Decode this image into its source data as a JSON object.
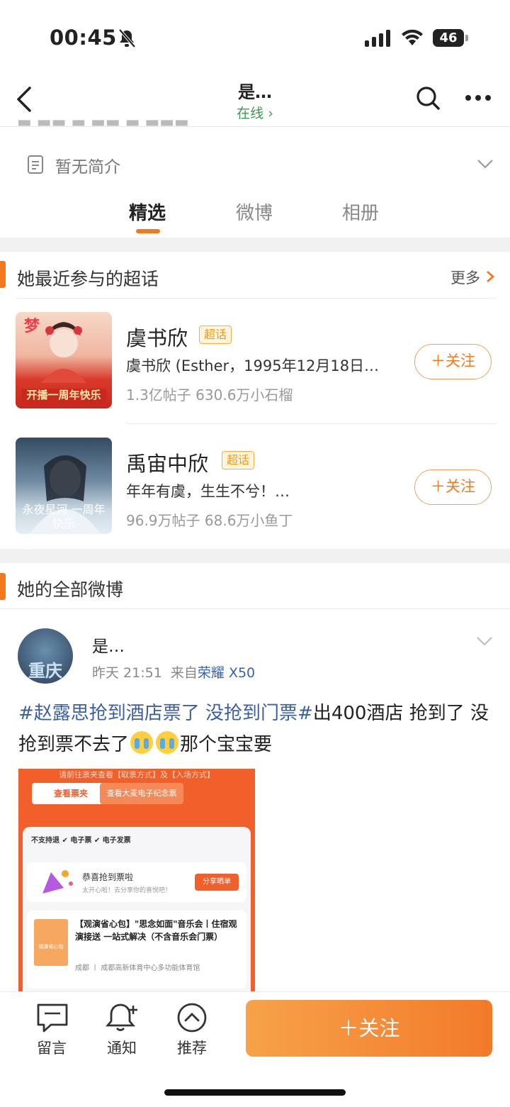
{
  "status": {
    "time": "00:45",
    "battery": "46"
  },
  "header": {
    "name": "是…",
    "online": "在线 ›"
  },
  "profile": {
    "intro": "暂无简介"
  },
  "tabs": [
    "精选",
    "微博",
    "相册"
  ],
  "topics_section": {
    "title": "她最近参与的超话",
    "more": "更多",
    "items": [
      {
        "name": "虞书欣",
        "badge": "超话",
        "desc": "虞书欣 (Esther，1995年12月18日…",
        "stats": "1.3亿帖子 630.6万小石榴",
        "follow": "＋关注",
        "thumb_text_top": "梦",
        "thumb_text_bottom": "开播一周年快乐"
      },
      {
        "name": "禹宙中欣",
        "badge": "超话",
        "desc": "年年有虞，生生不兮！…",
        "stats": "96.9万帖子 68.6万小鱼丁",
        "follow": "＋关注",
        "thumb_text": "永夜星河 一周年快乐"
      }
    ]
  },
  "posts_section": {
    "title": "她的全部微博",
    "post": {
      "author": "是…",
      "avatar_text": "重庆",
      "time": "昨天 21:51",
      "source_prefix": "来自",
      "source": "荣耀 X50",
      "tag": "#赵露思抢到酒店票了 没抢到门票#",
      "text_a": "出400酒店 抢到了 没抢到票不去了",
      "text_b": "那个宝宝要",
      "image": {
        "top_note": "请前往票夹查看【取票方式】及【入场方式】",
        "btn_ticket": "查看票夹",
        "btn_souvenir": "查看大麦电子纪念票",
        "row": "不支持退  ✔ 电子票  ✔ 电子发票",
        "win_title": "恭喜抢到票啦",
        "win_sub": "太开心啦！去分享你的喜悦吧！",
        "share": "分享晒单",
        "product": "【观演省心包】\"思念如面\"音乐会丨住宿观演接送 一站式解决（不含音乐会门票）",
        "location": "成都 丨 成都高新体育中心多功能体育馆",
        "prod_img_text": "观演省心包"
      }
    }
  },
  "bottom_bar": {
    "message": "留言",
    "notify": "通知",
    "recommend": "推荐",
    "follow": "＋关注"
  },
  "colors": {
    "accent": "#f27a1d",
    "link": "#3b5fa3",
    "online": "#3a9a52"
  }
}
